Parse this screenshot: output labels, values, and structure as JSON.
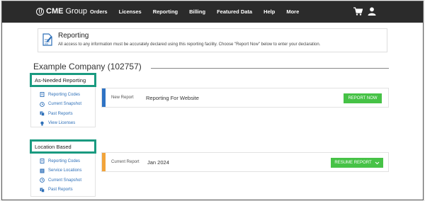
{
  "colors": {
    "nav_bg": "#2b2b2b",
    "accent_green": "#46c246",
    "highlight_teal": "#1a9a80",
    "stripe_blue": "#2f73c4",
    "stripe_orange": "#f2a43a",
    "link_blue": "#2d6fb8"
  },
  "nav": {
    "logo_bold": "CME",
    "logo_rest": "Group",
    "links": [
      "Orders",
      "Licenses",
      "Reporting",
      "Billing",
      "Featured Data",
      "Help",
      "More"
    ],
    "cart_icon": "shopping-cart-icon",
    "user_icon": "user-icon"
  },
  "banner": {
    "icon": "document-edit-icon",
    "title": "Reporting",
    "description": "All access to any information must be accurately declared using this reporting facility. Choose \"Report Now\" below to enter your declaration."
  },
  "company": {
    "title": "Example Company (102757)"
  },
  "sidebar_as_needed": {
    "heading": "As-Needed Reporting",
    "items": [
      {
        "label": "Reporting Codes",
        "icon": "document-icon"
      },
      {
        "label": "Current Snapshot",
        "icon": "clock-icon"
      },
      {
        "label": "Past Reports",
        "icon": "copy-icon"
      },
      {
        "label": "View Licenses",
        "icon": "lightbulb-icon"
      }
    ]
  },
  "sidebar_location": {
    "heading": "Location Based",
    "items": [
      {
        "label": "Reporting Codes",
        "icon": "document-icon"
      },
      {
        "label": "Service Locations",
        "icon": "list-icon"
      },
      {
        "label": "Current Snapshot",
        "icon": "clock-icon"
      },
      {
        "label": "Past Reports",
        "icon": "copy-icon"
      }
    ]
  },
  "new_report": {
    "label": "New Report",
    "value": "Reporting For Website",
    "button": "REPORT NOW"
  },
  "current_report": {
    "label": "Current Report",
    "value": "Jan 2024",
    "button": "RESUME REPORT",
    "button_icon": "chevron-down-icon"
  }
}
